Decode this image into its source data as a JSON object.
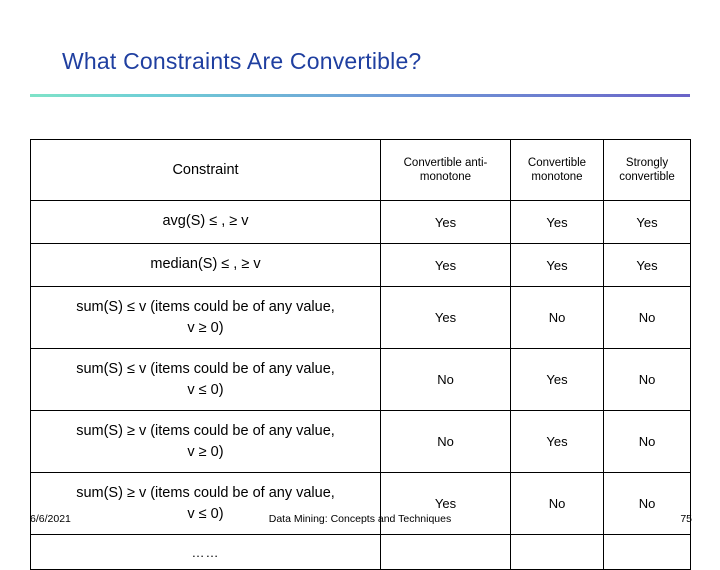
{
  "slide": {
    "title": "What Constraints Are Convertible?",
    "footer": {
      "date": "6/6/2021",
      "center": "Data Mining: Concepts and Techniques",
      "page": "75"
    }
  },
  "table": {
    "headers": {
      "constraint": "Constraint",
      "anti_monotone_line1": "Convertible anti-",
      "anti_monotone_line2": "monotone",
      "monotone_line1": "Convertible",
      "monotone_line2": "monotone",
      "strongly_line1": "Strongly",
      "strongly_line2": "convertible"
    },
    "rows": [
      {
        "constraint_line1": "avg(S) ≤ , ≥ v",
        "constraint_line2": "",
        "anti": "Yes",
        "mono": "Yes",
        "strong": "Yes"
      },
      {
        "constraint_line1": "median(S) ≤ , ≥ v",
        "constraint_line2": "",
        "anti": "Yes",
        "mono": "Yes",
        "strong": "Yes"
      },
      {
        "constraint_line1": "sum(S) ≤ v (items could be of any value,",
        "constraint_line2": "v ≥ 0)",
        "anti": "Yes",
        "mono": "No",
        "strong": "No"
      },
      {
        "constraint_line1": "sum(S) ≤ v (items could be of any value,",
        "constraint_line2": "v ≤ 0)",
        "anti": "No",
        "mono": "Yes",
        "strong": "No"
      },
      {
        "constraint_line1": "sum(S) ≥ v (items could be of any value,",
        "constraint_line2": "v ≥ 0)",
        "anti": "No",
        "mono": "Yes",
        "strong": "No"
      },
      {
        "constraint_line1": "sum(S) ≥ v (items could be of any value,",
        "constraint_line2": "v ≤ 0)",
        "anti": "Yes",
        "mono": "No",
        "strong": "No"
      }
    ],
    "ellipsis_row": "……"
  }
}
